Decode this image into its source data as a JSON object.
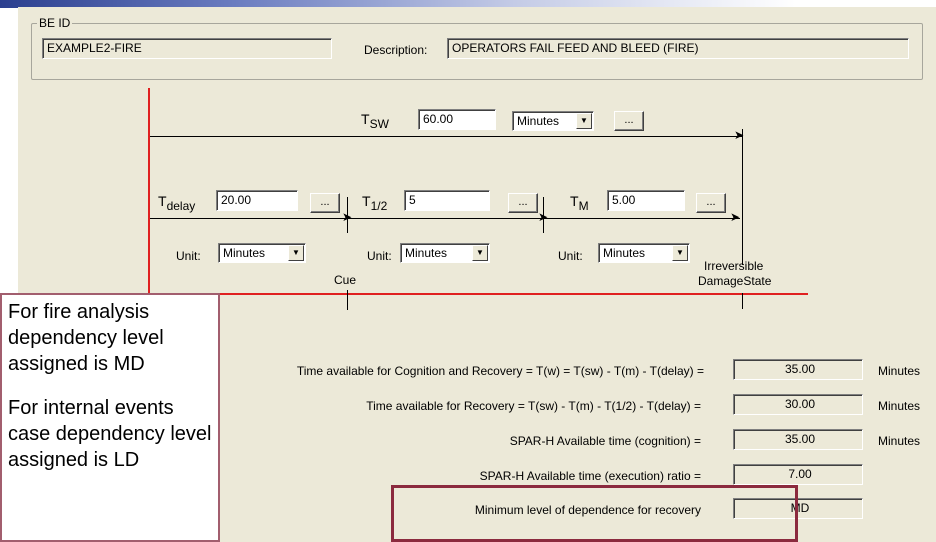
{
  "be_id": {
    "legend": "BE ID",
    "value": "EXAMPLE2-FIRE"
  },
  "description": {
    "label": "Description:",
    "value": "OPERATORS FAIL FEED AND BLEED (FIRE)"
  },
  "timeline": {
    "tsw": {
      "symbol": "T",
      "subscript": "SW",
      "value": "60.00",
      "unit": "Minutes",
      "button": "..."
    },
    "tdelay": {
      "symbol": "T",
      "subscript": "delay",
      "value": "20.00",
      "button": "...",
      "unit_label": "Unit:",
      "unit": "Minutes"
    },
    "thalf": {
      "symbol": "T",
      "subscript": "1/2",
      "value": "5",
      "button": "...",
      "unit_label": "Unit:",
      "unit": "Minutes"
    },
    "tm": {
      "symbol": "T",
      "subscript": "M",
      "value": "5.00",
      "button": "...",
      "unit_label": "Unit:",
      "unit": "Minutes"
    },
    "cue_label": "Cue",
    "irreversible_label_1": "Irreversible",
    "irreversible_label_2": "DamageState"
  },
  "results": [
    {
      "label": "Time available for Cognition and Recovery = T(w) = T(sw) - T(m) - T(delay) =",
      "value": "35.00",
      "unit": "Minutes"
    },
    {
      "label": "Time available for Recovery = T(sw) - T(m) - T(1/2) - T(delay) =",
      "value": "30.00",
      "unit": "Minutes"
    },
    {
      "label": "SPAR-H Available time (cognition) =",
      "value": "35.00",
      "unit": "Minutes"
    },
    {
      "label": "SPAR-H Available time (execution) ratio =",
      "value": "7.00",
      "unit": ""
    },
    {
      "label": "Minimum level of dependence for recovery",
      "value": "MD",
      "unit": ""
    }
  ],
  "callout": {
    "para1": "For fire analysis dependency level assigned is MD",
    "para2": "For internal events case dependency level assigned is LD"
  },
  "colors": {
    "accent_red": "#e02020",
    "highlight_border": "#8b2a3e",
    "dialog_bg": "#ece9d8"
  }
}
